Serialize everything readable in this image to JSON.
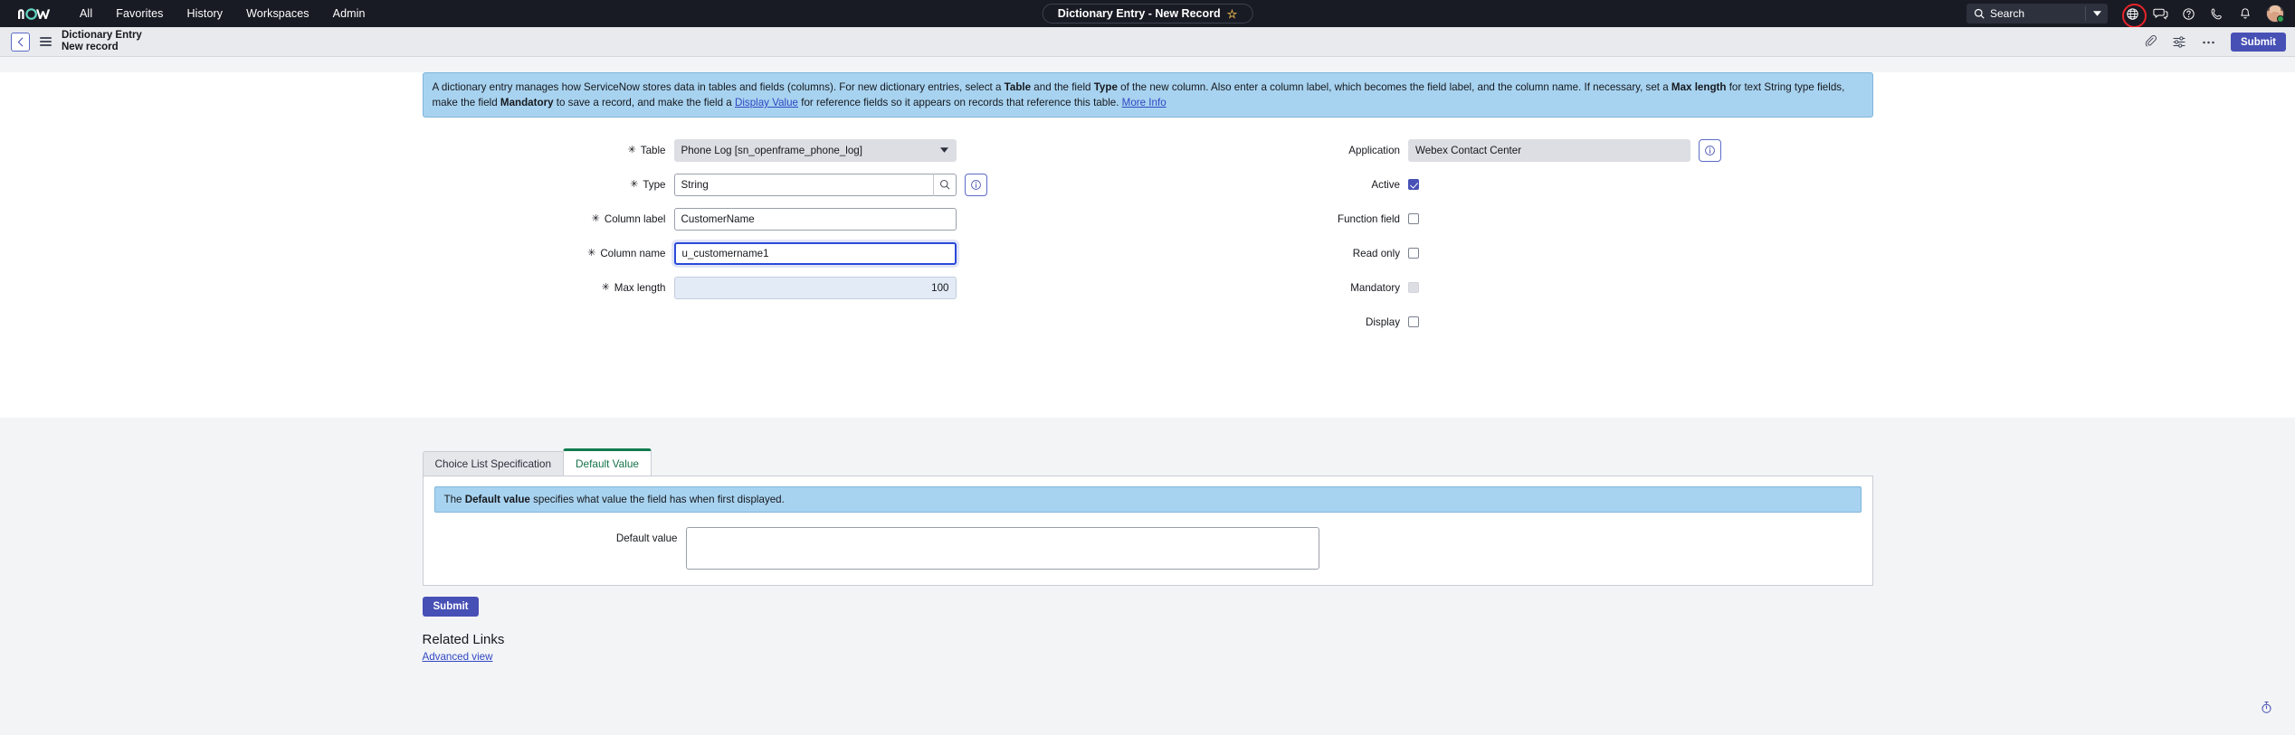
{
  "topnav": {
    "logo_text": "now",
    "links": [
      {
        "label": "All",
        "name": "nav-all"
      },
      {
        "label": "Favorites",
        "name": "nav-favorites"
      },
      {
        "label": "History",
        "name": "nav-history"
      },
      {
        "label": "Workspaces",
        "name": "nav-workspaces"
      },
      {
        "label": "Admin",
        "name": "nav-admin"
      }
    ],
    "record_pill": "Dictionary Entry - New Record",
    "star": "☆",
    "search_placeholder": "Search",
    "search_value": "",
    "icons": [
      {
        "name": "globe-icon",
        "highlight": true
      },
      {
        "name": "conversations-icon",
        "highlight": false
      },
      {
        "name": "help-icon",
        "highlight": false
      },
      {
        "name": "phone-icon",
        "highlight": false
      },
      {
        "name": "notifications-bell-icon",
        "highlight": false
      }
    ],
    "highlight_color": "#e8232a",
    "bg_color": "#181b23"
  },
  "formbar": {
    "title": "Dictionary Entry",
    "subtitle": "New record",
    "icons": [
      "attachment-icon",
      "personalize-form-icon",
      "more-options-icon"
    ],
    "submit_label": "Submit",
    "accent_color": "#4750b5"
  },
  "banner": {
    "part1": "A dictionary entry manages how ServiceNow stores data in tables and fields (columns). For new dictionary entries, select a ",
    "b_table": "Table",
    "part2": " and the field ",
    "b_type": "Type",
    "part3": " of the new column. Also enter a column label, which becomes the field label, and the column name. If necessary, set a ",
    "b_maxlength": "Max length",
    "part4": " for text String type fields, make the field ",
    "b_mandatory": "Mandatory",
    "part5": " to save a record, and make the field a ",
    "link_display_value": "Display Value",
    "part6": " for reference fields so it appears on records that reference this table. ",
    "link_more_info": "More Info",
    "bg_color": "#a8d3f0"
  },
  "form": {
    "left": [
      {
        "label": "Table",
        "required": true,
        "type": "select",
        "value": "Phone Log [sn_openframe_phone_log]",
        "name": "table-field"
      },
      {
        "label": "Type",
        "required": true,
        "type": "lookup",
        "value": "String",
        "name": "type-field"
      },
      {
        "label": "Column label",
        "required": true,
        "type": "text",
        "value": "CustomerName",
        "name": "column-label-field"
      },
      {
        "label": "Column name",
        "required": true,
        "type": "text",
        "value": "u_customername1",
        "focused": true,
        "name": "column-name-field"
      },
      {
        "label": "Max length",
        "required": true,
        "type": "number",
        "value": "100",
        "name": "max-length-field"
      }
    ],
    "right": [
      {
        "label": "Application",
        "required": false,
        "type": "readonly",
        "value": "Webex Contact Center",
        "info": true,
        "name": "application-field"
      },
      {
        "label": "Active",
        "required": false,
        "type": "checkbox",
        "checked": true,
        "name": "active-checkbox"
      },
      {
        "label": "Function field",
        "required": false,
        "type": "checkbox",
        "checked": false,
        "name": "function-field-checkbox"
      },
      {
        "label": "Read only",
        "required": false,
        "type": "checkbox",
        "checked": false,
        "name": "read-only-checkbox"
      },
      {
        "label": "Mandatory",
        "required": false,
        "type": "checkbox",
        "checked": false,
        "disabled": true,
        "name": "mandatory-checkbox"
      },
      {
        "label": "Display",
        "required": false,
        "type": "checkbox",
        "checked": false,
        "name": "display-checkbox"
      }
    ],
    "required_marker": "✳"
  },
  "tabs": [
    {
      "label": "Choice List Specification",
      "active": false,
      "name": "tab-choice-list-specification"
    },
    {
      "label": "Default Value",
      "active": true,
      "name": "tab-default-value"
    }
  ],
  "tabpanel": {
    "banner_prefix": "The ",
    "banner_bold": "Default value",
    "banner_suffix": " specifies what value the field has when first displayed.",
    "default_value_label": "Default value",
    "default_value": "",
    "submit_label": "Submit",
    "active_tab_color": "#0f7b4f"
  },
  "related_links": {
    "title": "Related Links",
    "links": [
      {
        "label": "Advanced view",
        "name": "advanced-view-link"
      }
    ]
  },
  "bottom": {
    "icon": "stopwatch-icon"
  }
}
